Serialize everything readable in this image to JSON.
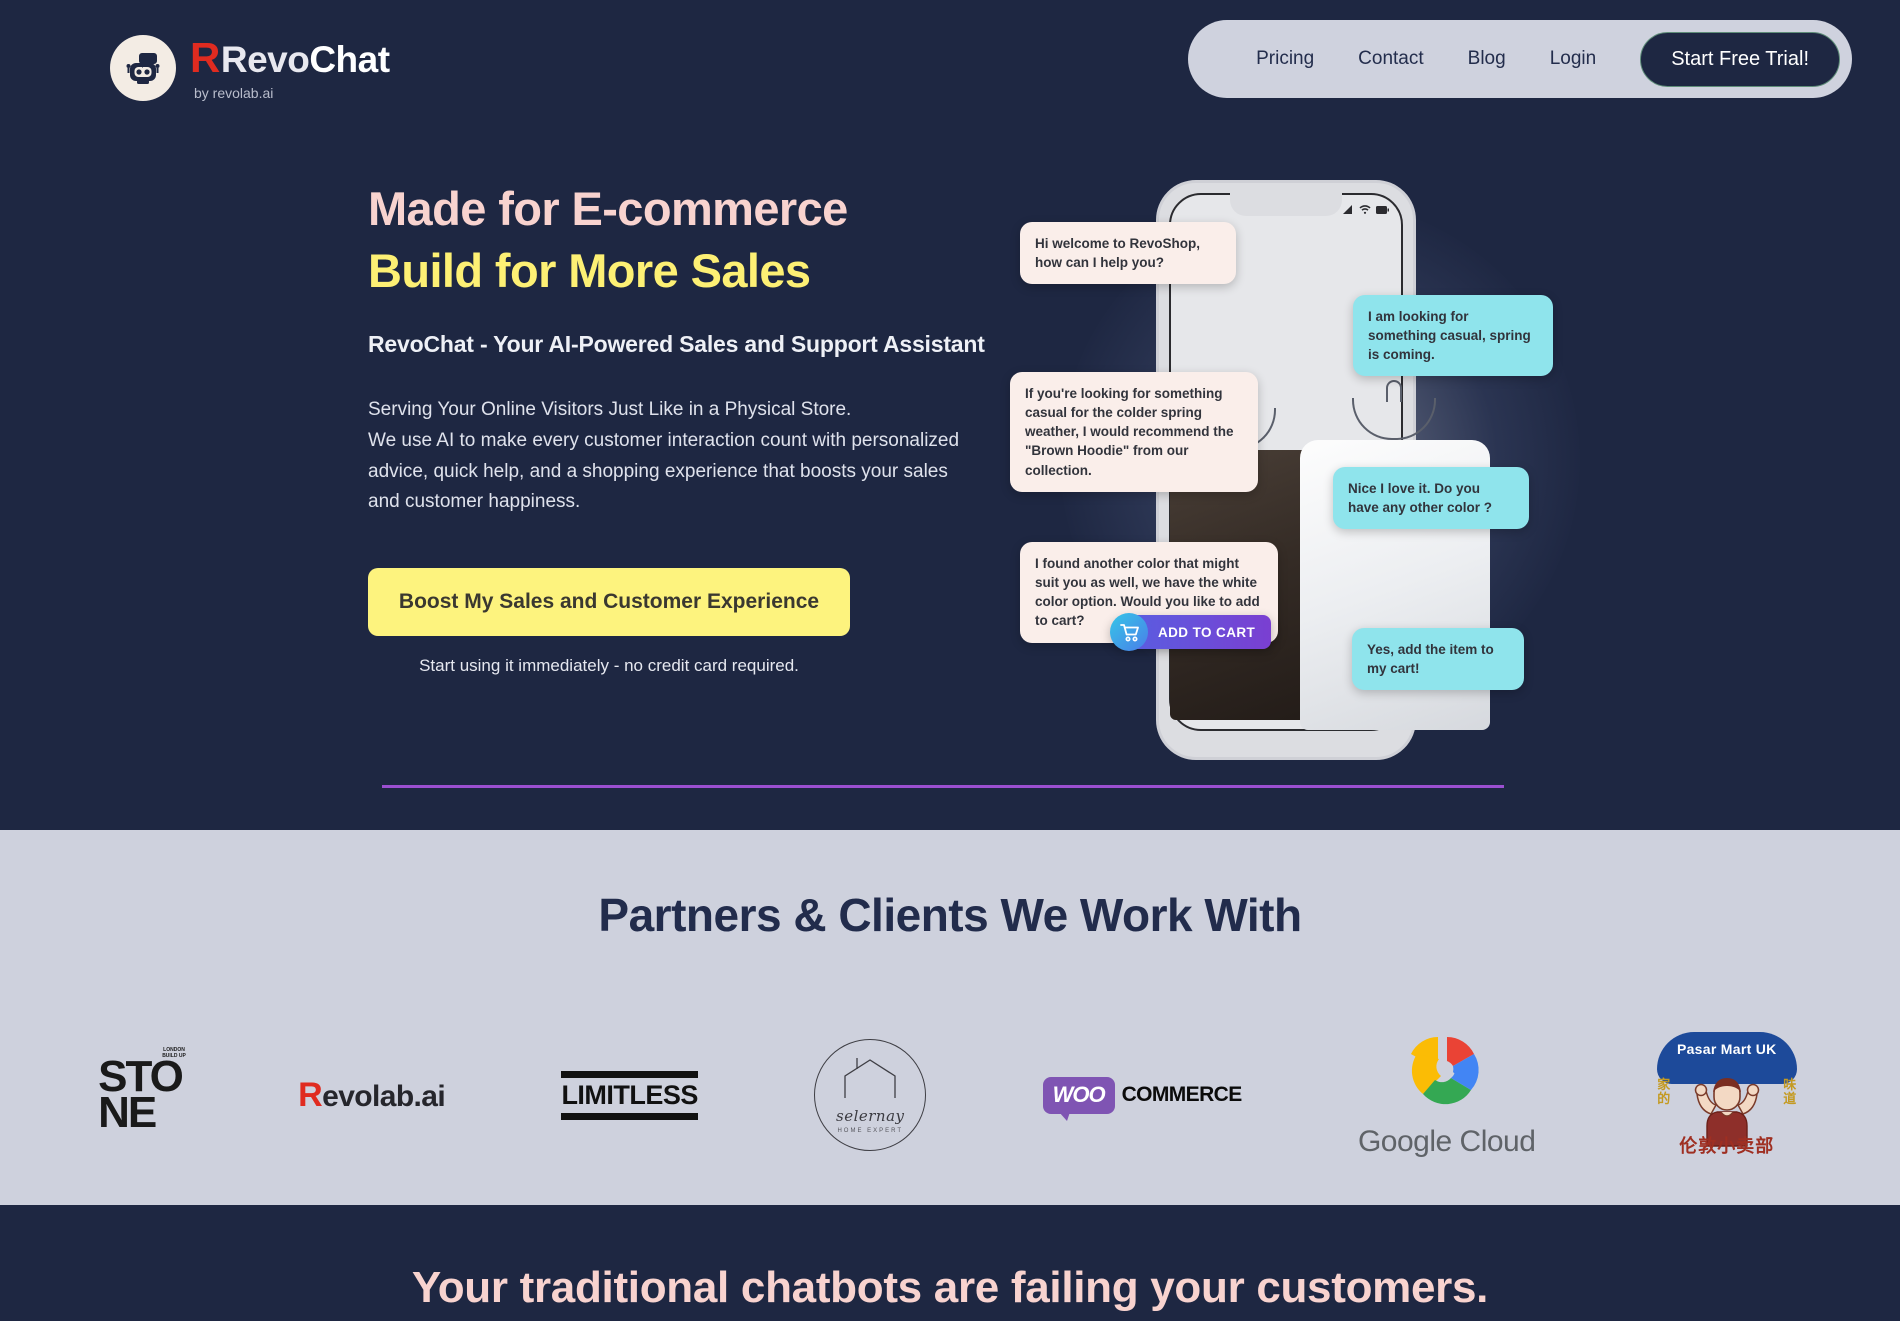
{
  "brand": {
    "logo_icon": "robot-chat-icon",
    "name_part1": "Revo",
    "name_part2": "Chat",
    "r_letter": "R",
    "tagline": "by revolab.ai"
  },
  "nav": {
    "items": [
      {
        "label": "Pricing"
      },
      {
        "label": "Contact"
      },
      {
        "label": "Blog"
      },
      {
        "label": "Login"
      }
    ],
    "cta_label": "Start Free Trial!"
  },
  "hero": {
    "headline_line1": "Made for E-commerce",
    "headline_line2": "Build for More Sales",
    "headline_line1_color": "#f8d3cf",
    "headline_line2_color": "#fdf074",
    "subheading": "RevoChat - Your AI-Powered Sales and Support Assistant",
    "body": "Serving Your Online Visitors Just Like in a Physical Store. We use AI to make every customer interaction count with personalized advice, quick help, and a shopping experience that boosts your sales and customer happiness.",
    "body_line1": "Serving Your Online Visitors Just Like in a Physical Store.",
    "body_rest": "We use AI to make every customer interaction count with personalized advice, quick help, and a shopping experience that boosts your sales and customer happiness.",
    "cta_label": "Boost My Sales and Customer Experience",
    "cta_color": "#fdf37e",
    "cta_note": "Start using it immediately - no credit card required.",
    "divider_color": "#9b4fd0"
  },
  "chat_mockup": {
    "bot_bubble_color": "#faeeea",
    "user_bubble_color": "#8fe4ec",
    "messages": [
      {
        "from": "bot",
        "text": "Hi welcome to RevoShop, how can I help you?"
      },
      {
        "from": "user",
        "text": "I am looking for something casual, spring is coming."
      },
      {
        "from": "bot",
        "text": "If you're looking for something casual for the colder spring weather, I would recommend the \"Brown Hoodie\" from our collection."
      },
      {
        "from": "user",
        "text": "Nice I love it. Do you have any other color ?"
      },
      {
        "from": "bot",
        "text": "I found another color that might suit you as well, we have the white color option. Would you like to add to cart?"
      },
      {
        "from": "user",
        "text": "Yes, add the item to my cart!"
      }
    ],
    "add_to_cart_label": "ADD TO CART",
    "cart_icon": "shopping-cart-icon",
    "status_icons": [
      "signal-icon",
      "wifi-icon",
      "battery-icon"
    ]
  },
  "partners": {
    "title": "Partners & Clients We Work With",
    "background": "#ced1dd",
    "logos": [
      {
        "name": "stone",
        "text": "STO",
        "text2": "NE",
        "tag": "LONDON\nBUILD UP"
      },
      {
        "name": "revolab",
        "r": "R",
        "text": "evolab.ai"
      },
      {
        "name": "limitless",
        "text": "LIMITLESS"
      },
      {
        "name": "selernay",
        "text": "selernay",
        "sub": "HOME EXPERT"
      },
      {
        "name": "woocommerce",
        "badge": "WOO",
        "text": "COMMERCE"
      },
      {
        "name": "google-cloud",
        "text": "Google Cloud"
      },
      {
        "name": "pasar-mart-uk",
        "text": "Pasar Mart UK",
        "cn_left": "家的",
        "cn_right": "味道",
        "cn_bottom": "伦敦小卖部"
      }
    ]
  },
  "bottom_section": {
    "title": "Your traditional chatbots are failing your customers.",
    "title_color": "#f8d3cf"
  }
}
